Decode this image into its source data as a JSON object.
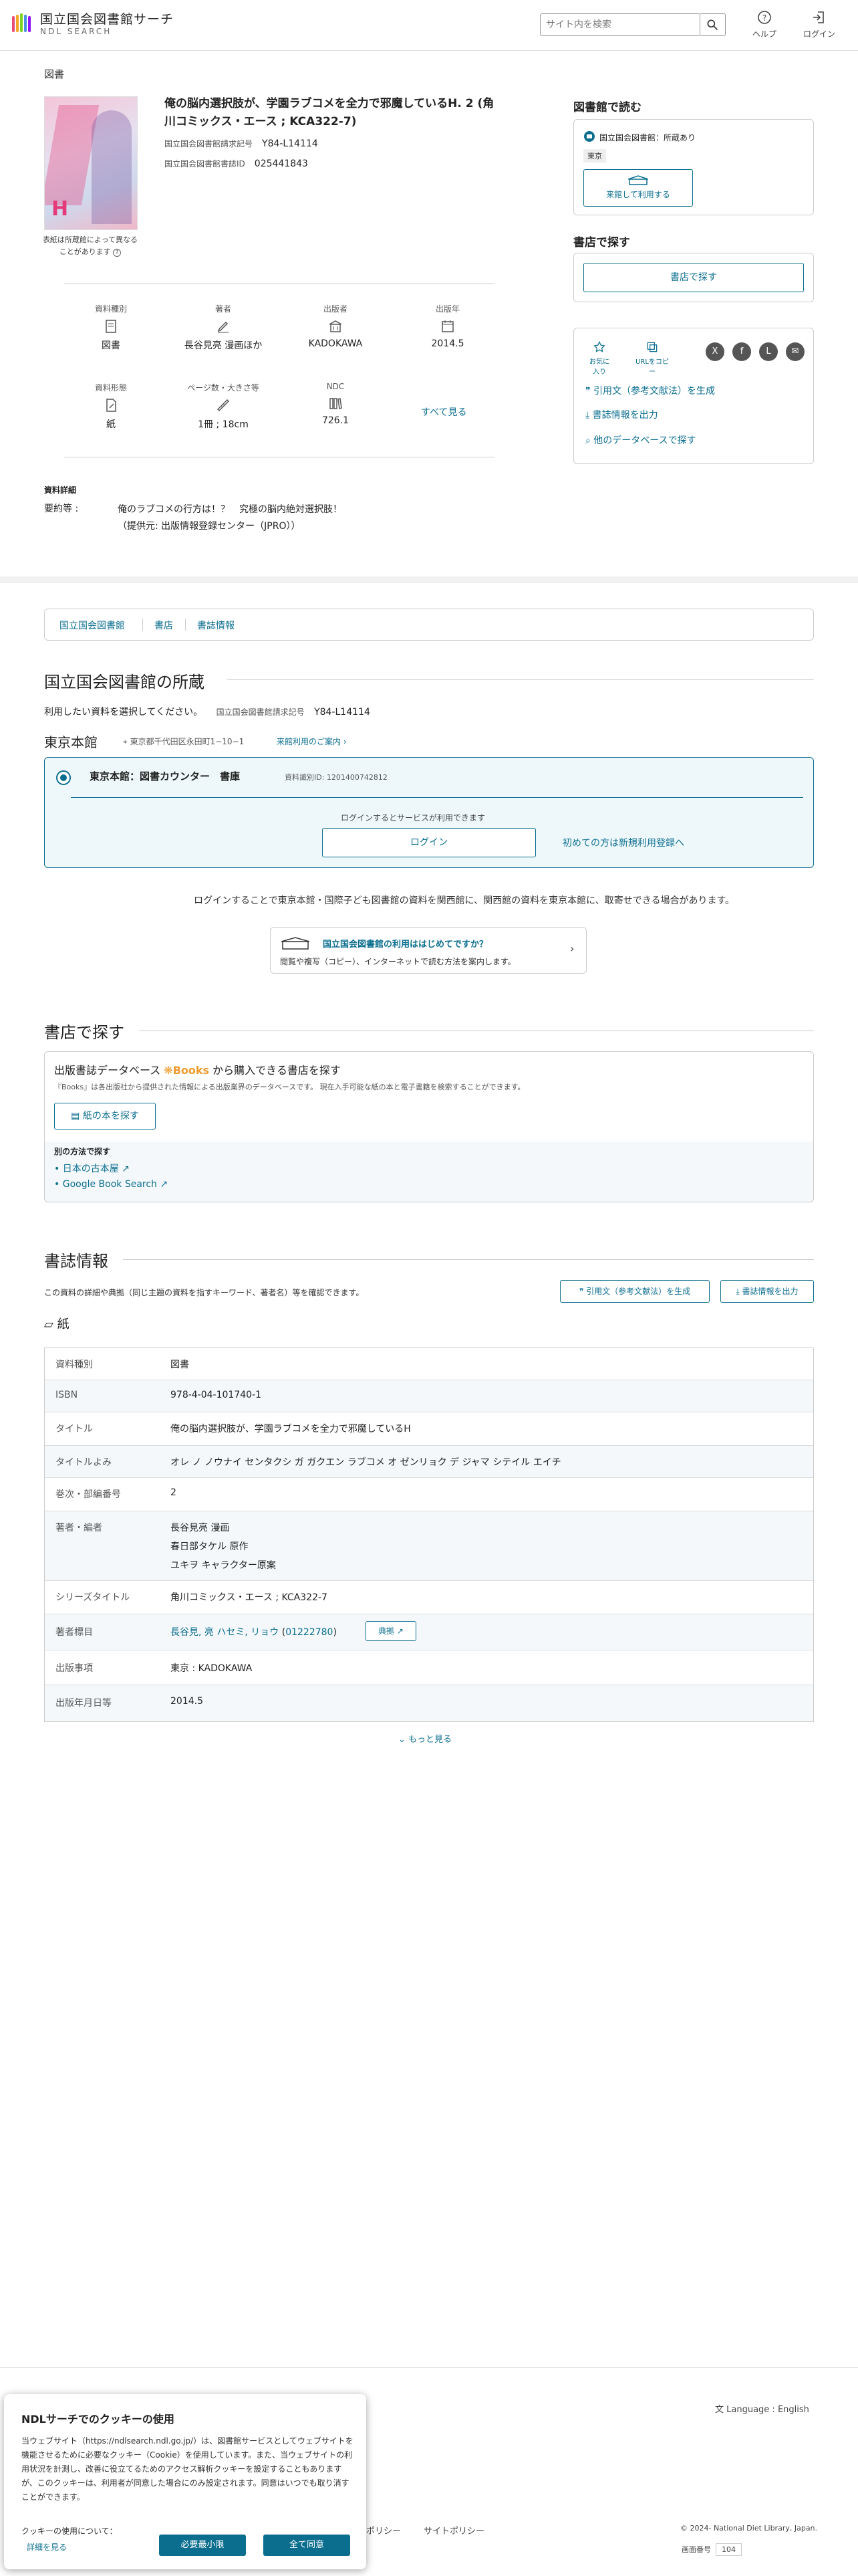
{
  "header": {
    "logo_title": "国立国会図書館サーチ",
    "logo_sub": "NDL SEARCH",
    "search_placeholder": "サイト内を検索",
    "help": "ヘルプ",
    "login": "ログイン"
  },
  "breadcrumb": "図書",
  "book": {
    "title": "俺の脳内選択肢が、学園ラブコメを全力で邪魔しているH. 2 (角川コミックス・エース ; KCA322-7)",
    "call_no_label": "国立国会図書館請求記号",
    "call_no": "Y84-L14114",
    "biblio_id_label": "国立国会図書館書誌ID",
    "biblio_id": "025441843",
    "cover_note": "表紙は所蔵館によって異なることがあります"
  },
  "attributes": [
    {
      "label": "資料種別",
      "value": "図書",
      "icon": "document-icon"
    },
    {
      "label": "著者",
      "value": "長谷見亮 漫画ほか",
      "icon": "pen-icon"
    },
    {
      "label": "出版者",
      "value": "KADOKAWA",
      "icon": "building-icon"
    },
    {
      "label": "出版年",
      "value": "2014.5",
      "icon": "calendar-icon"
    },
    {
      "label": "資料形態",
      "value": "紙",
      "icon": "paper-icon"
    },
    {
      "label": "ページ数・大きさ等",
      "value": "1冊 ; 18cm",
      "icon": "ruler-icon"
    },
    {
      "label": "NDC",
      "value": "726.1",
      "icon": "books-icon"
    }
  ],
  "see_all": "すべて見る",
  "detail": {
    "heading": "資料詳細",
    "summary_label": "要約等 :",
    "summary_line1": "俺のラブコメの行方は！？　究極の脳内絶対選択肢！",
    "summary_line2": "（提供元: 出版情報登録センター（JPRO））"
  },
  "right": {
    "read_heading": "図書館で読む",
    "holding_text": "国立国会図書館：所蔵あり",
    "tokyo_tag": "東京",
    "visit_btn": "来館して利用する",
    "store_heading": "書店で探す",
    "store_btn": "書店で探す",
    "fav": "お気に入り",
    "copy_url": "URLをコピー",
    "cite": "引用文（参考文献法）を生成",
    "export": "書誌情報を出力",
    "other_db": "他のデータベースで探す"
  },
  "tabs": [
    "国立国会図書館",
    "書店",
    "書誌情報"
  ],
  "holdings": {
    "heading": "国立国会図書館の所蔵",
    "select_text": "利用したい資料を選択してください。",
    "call_no_label": "国立国会図書館請求記号",
    "call_no": "Y84-L14114",
    "branch": "東京本館",
    "address": "東京都千代田区永田町1−10−1",
    "visit_guide": "来館利用のご案内",
    "location": "東京本館：図書カウンター　書庫",
    "item_id": "資料識別ID: 1201400742812",
    "login_hint": "ログインするとサービスが利用できます",
    "login_btn": "ログイン",
    "register": "初めての方は新規利用登録へ",
    "note": "ログインすることで東京本館・国際子ども図書館の資料を関西館に、関西館の資料を東京本館に、取寄せできる場合があります。",
    "first_time_title": "国立国会図書館の利用ははじめてですか？",
    "first_time_desc": "閲覧や複写（コピー）、インターネットで読む方法を案内します。"
  },
  "store": {
    "heading": "書店で探す",
    "db_text_pre": "出版書誌データベース",
    "db_name": "Books",
    "db_text_post": "から購入できる書店を探す",
    "desc": "『Books』は各出版社から提供された情報による出版業界のデータベースです。 現在入手可能な紙の本と電子書籍を検索することができます。",
    "paper_btn": "紙の本を探す",
    "other_label": "別の方法で探す",
    "links": [
      "日本の古本屋",
      "Google Book Search"
    ]
  },
  "biblio": {
    "heading": "書誌情報",
    "desc": "この資料の詳細や典拠（同じ主題の資料を指すキーワード、著者名）等を確認できます。",
    "cite_btn": "引用文（参考文献法）を生成",
    "export_btn": "書誌情報を出力",
    "format": "紙",
    "rows": [
      {
        "k": "資料種別",
        "v": "図書"
      },
      {
        "k": "ISBN",
        "v": "978-4-04-101740-1"
      },
      {
        "k": "タイトル",
        "v": "俺の脳内選択肢が、学園ラブコメを全力で邪魔しているH"
      },
      {
        "k": "タイトルよみ",
        "v": "オレ ノ ノウナイ センタクシ ガ ガクエン ラブコメ オ ゼンリョク デ ジャマ シテイル エイチ"
      },
      {
        "k": "巻次・部編番号",
        "v": "2"
      },
      {
        "k": "著者・編者",
        "v": "長谷見亮 漫画"
      },
      {
        "k": "シリーズタイトル",
        "v": "角川コミックス・エース ; KCA322-7"
      },
      {
        "k": "著者標目",
        "v": "長谷見, 亮 ハセミ, リョウ"
      },
      {
        "k": "出版事項",
        "v": "東京 : KADOKAWA"
      },
      {
        "k": "出版年月日等",
        "v": "2014.5"
      }
    ],
    "authors_extra": [
      "春日部タケル 原作",
      "ユキヲ キャラクター原案"
    ],
    "author_id": "01222780",
    "authority_btn": "典拠",
    "more": "もっと見る"
  },
  "footer": {
    "language": "Language : English",
    "policy1": "ポリシー",
    "policy2": "サイトポリシー",
    "copyright": "© 2024- National Diet Library, Japan.",
    "screen_no_label": "画面番号",
    "screen_no": "104"
  },
  "cookie": {
    "title": "NDLサーチでのクッキーの使用",
    "body": "当ウェブサイト（https://ndlsearch.ndl.go.jp/）は、図書館サービスとしてウェブサイトを機能させるために必要なクッキー（Cookie）を使用しています。また、当ウェブサイトの利用状況を計測し、改善に役立てるためのアクセス解析クッキーを設定することもありますが、このクッキーは、利用者が同意した場合にのみ設定されます。同意はいつでも取り消すことができます。",
    "about": "クッキーの使用について：",
    "details": "詳細を見る",
    "minimum": "必要最小限",
    "accept": "全て同意"
  }
}
